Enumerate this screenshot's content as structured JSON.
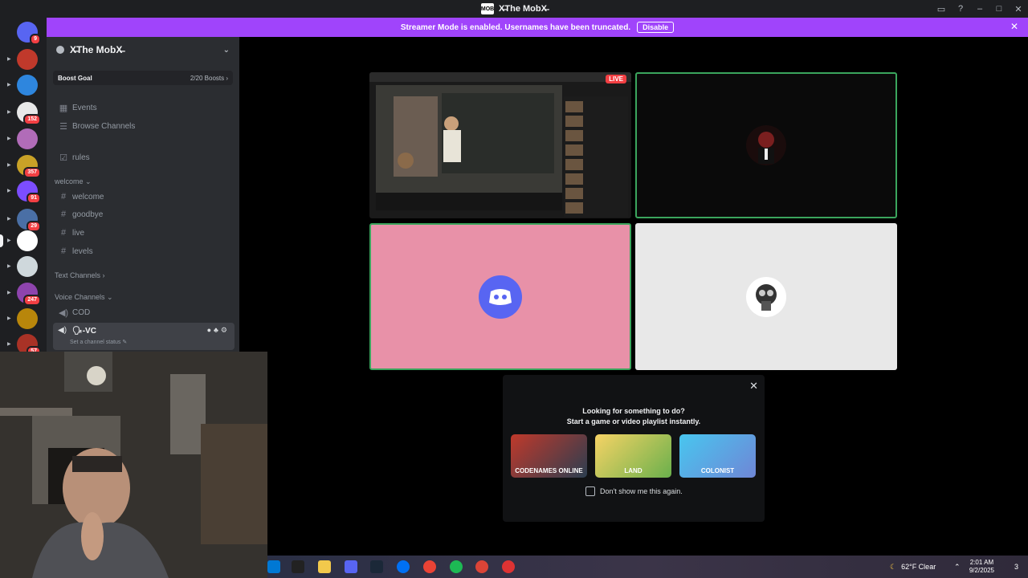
{
  "titlebar": {
    "logo": "MOB",
    "title": "X̶The MobX̶",
    "controls": [
      "inbox-icon",
      "help-icon",
      "minimize-icon",
      "maximize-icon",
      "close-icon"
    ]
  },
  "rail": {
    "servers": [
      {
        "name": "discord-home",
        "badge": "9",
        "color": "#5865f2"
      },
      {
        "name": "server-red-face",
        "badge": "",
        "color": "#c0392b"
      },
      {
        "name": "server-blue-avatar",
        "badge": "",
        "color": "#2e86de"
      },
      {
        "name": "server-white-hand",
        "badge": "152",
        "color": "#e8e8e8"
      },
      {
        "name": "server-anime",
        "badge": "",
        "color": "#b16cb8"
      },
      {
        "name": "server-yellow",
        "badge": "357",
        "color": "#c9a227"
      },
      {
        "name": "server-w",
        "badge": "91",
        "color": "#7c4dff"
      },
      {
        "name": "server-mixed",
        "badge": "29",
        "color": "#4a6fa5"
      },
      {
        "name": "server-mob",
        "badge": "",
        "color": "#ffffff"
      },
      {
        "name": "server-cartoon",
        "badge": "",
        "color": "#cfd8dc"
      },
      {
        "name": "server-gamer",
        "badge": "247",
        "color": "#8e44ad"
      },
      {
        "name": "server-wings",
        "badge": "",
        "color": "#b8860b"
      },
      {
        "name": "server-red-mask",
        "badge": "57",
        "color": "#a93226"
      }
    ]
  },
  "sidebar": {
    "guild_name": "X̶The MobX̶",
    "boost_label": "Boost Goal",
    "boost_count": "2/20 Boosts ›",
    "events": "Events",
    "browse": "Browse Channels",
    "rules": "rules",
    "cat_welcome": "welcome ⌄",
    "welcome": "welcome",
    "goodbye": "goodbye",
    "live": "live",
    "levels": "levels",
    "cat_text": "Text Channels ›",
    "cat_voice": "Voice Channels ⌄",
    "cod": "COD",
    "vc_name": "🗣-VC",
    "vc_status": "Set a channel status ✎"
  },
  "banner": {
    "text": "Streamer Mode is enabled. Usernames have been truncated.",
    "disable": "Disable"
  },
  "stage": {
    "live_label": "LIVE",
    "tile_colors": {
      "speaker_border": "#3ba55d",
      "pink": "#e891a8",
      "gray": "#e8e8e8",
      "dark": "#0a0a0a"
    }
  },
  "suggest": {
    "line1": "Looking for something to do?",
    "line2": "Start a game or video playlist instantly.",
    "games": [
      "CODENAMES ONLINE",
      "LAND",
      "COLONIST"
    ],
    "dont_show": "Don't show me this again."
  },
  "taskbar": {
    "weather": "62°F  Clear",
    "time": "2:01 AM",
    "date": "9/2/2025",
    "notif": "3"
  }
}
